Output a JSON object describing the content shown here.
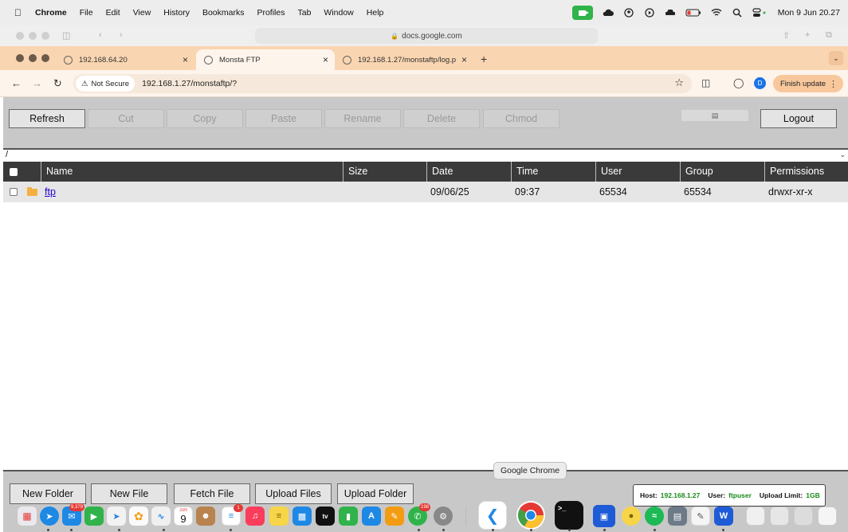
{
  "menubar": {
    "app_name": "Chrome",
    "menus": [
      "File",
      "Edit",
      "View",
      "History",
      "Bookmarks",
      "Profiles",
      "Tab",
      "Window",
      "Help"
    ],
    "clock": "Mon 9 Jun  20.27"
  },
  "safari": {
    "url": "docs.google.com"
  },
  "tabs": [
    {
      "title": "192.168.64.20"
    },
    {
      "title": "Monsta FTP"
    },
    {
      "title": "192.168.1.27/monstaftp/log.p"
    }
  ],
  "toolbar": {
    "security_label": "Not Secure",
    "url": "192.168.1.27/monstaftp/?",
    "profile_initial": "D",
    "finish_update_label": "Finish update"
  },
  "ftp": {
    "buttons": {
      "refresh": "Refresh",
      "cut": "Cut",
      "copy": "Copy",
      "paste": "Paste",
      "rename": "Rename",
      "delete": "Delete",
      "chmod": "Chmod",
      "logout": "Logout"
    },
    "path": "/",
    "columns": [
      "Name",
      "Size",
      "Date",
      "Time",
      "User",
      "Group",
      "Permissions"
    ],
    "rows": [
      {
        "name": "ftp",
        "size": "",
        "date": "09/06/25",
        "time": "09:37",
        "user": "65534",
        "group": "65534",
        "permissions": "drwxr-xr-x"
      }
    ],
    "bottom_buttons": {
      "new_folder": "New Folder",
      "new_file": "New File",
      "fetch_file": "Fetch File",
      "upload_files": "Upload Files",
      "upload_folder": "Upload Folder"
    },
    "status": {
      "host_label": "Host:",
      "host_value": "192.168.1.27",
      "user_label": "User:",
      "user_value": "ftpuser",
      "limit_label": "Upload Limit:",
      "limit_value": "1GB"
    }
  },
  "dock": {
    "tooltip": "Google Chrome",
    "calendar_day": "9",
    "calendar_month": "JUN",
    "mail_badge": "9,379",
    "reminders_badge": "1",
    "whatsapp_badge": "198",
    "tv_label": "tv",
    "terminal_prompt": ">_"
  },
  "colors": {
    "tab_strip": "#f9d5b1",
    "table_header": "#3a3a3a",
    "status_green": "#1a8a1a",
    "link": "#2200cc"
  }
}
